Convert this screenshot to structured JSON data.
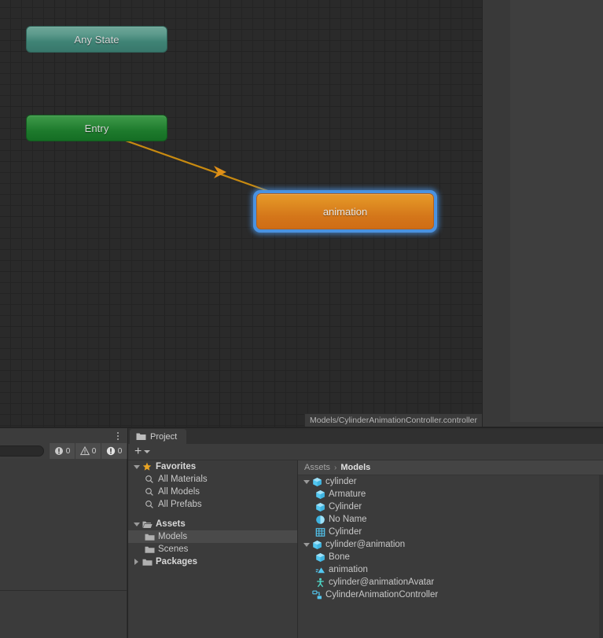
{
  "animator": {
    "nodes": [
      {
        "id": "any-state",
        "label": "Any State",
        "type": "any-state"
      },
      {
        "id": "entry",
        "label": "Entry",
        "type": "entry"
      },
      {
        "id": "animation",
        "label": "animation",
        "type": "state",
        "selected": true
      }
    ],
    "transitions": [
      {
        "from": "entry",
        "to": "animation",
        "color": "#c88a10"
      }
    ],
    "breadcrumb": "Models/CylinderAnimationController.controller",
    "colors": {
      "canvas_bg": "#2a2a2a",
      "grid_line": "#222222",
      "any_state": "#3f8375",
      "entry": "#1d7a2c",
      "state": "#d4761a",
      "selection": "#4a92e0",
      "transition": "#c88a10"
    }
  },
  "console": {
    "search_value": "",
    "search_placeholder": "",
    "counters": [
      {
        "name": "log",
        "icon": "log-icon",
        "count": "0"
      },
      {
        "name": "warning",
        "icon": "warning-icon",
        "count": "0"
      },
      {
        "name": "error",
        "icon": "error-icon",
        "count": "0"
      }
    ],
    "menu_icon": "kebab-menu-icon"
  },
  "project": {
    "tab_label": "Project",
    "tab_icon": "folder-icon",
    "toolbar": {
      "add_label": "+",
      "add_icon": "plus-icon",
      "dropdown_icon": "chevron-down-icon"
    },
    "tree": [
      {
        "label": "Favorites",
        "icon": "star-icon",
        "indent": 0,
        "twisty": "down",
        "bold": true
      },
      {
        "label": "All Materials",
        "icon": "search-icon",
        "indent": 1,
        "twisty": "none",
        "bold": false
      },
      {
        "label": "All Models",
        "icon": "search-icon",
        "indent": 1,
        "twisty": "none",
        "bold": false
      },
      {
        "label": "All Prefabs",
        "icon": "search-icon",
        "indent": 1,
        "twisty": "none",
        "bold": false
      },
      {
        "label": "Assets",
        "icon": "folder-open-icon",
        "indent": 0,
        "twisty": "down",
        "bold": true,
        "spacer_before": true
      },
      {
        "label": "Models",
        "icon": "folder-icon",
        "indent": 1,
        "twisty": "none",
        "bold": false,
        "selected": true
      },
      {
        "label": "Scenes",
        "icon": "folder-icon",
        "indent": 1,
        "twisty": "none",
        "bold": false
      },
      {
        "label": "Packages",
        "icon": "folder-icon",
        "indent": 0,
        "twisty": "right",
        "bold": true
      }
    ],
    "breadcrumb": {
      "root": "Assets",
      "separator": "›",
      "current": "Models"
    },
    "assets": [
      {
        "label": "cylinder",
        "icon": "prefab-model-icon",
        "indent": 0,
        "twisty": "down"
      },
      {
        "label": "Armature",
        "icon": "prefab-model-icon",
        "indent": 1,
        "twisty": "none"
      },
      {
        "label": "Cylinder",
        "icon": "prefab-model-icon",
        "indent": 1,
        "twisty": "none"
      },
      {
        "label": "No Name",
        "icon": "material-icon",
        "indent": 1,
        "twisty": "none"
      },
      {
        "label": "Cylinder",
        "icon": "mesh-icon",
        "indent": 1,
        "twisty": "none"
      },
      {
        "label": "cylinder@animation",
        "icon": "prefab-model-icon",
        "indent": 0,
        "twisty": "down"
      },
      {
        "label": "Bone",
        "icon": "prefab-model-icon",
        "indent": 1,
        "twisty": "none"
      },
      {
        "label": "animation",
        "icon": "animation-clip-icon",
        "indent": 1,
        "twisty": "none"
      },
      {
        "label": "cylinder@animationAvatar",
        "icon": "avatar-icon",
        "indent": 1,
        "twisty": "none"
      },
      {
        "label": "CylinderAnimationController",
        "icon": "animator-controller-icon",
        "indent": 0,
        "twisty": "none"
      }
    ]
  }
}
